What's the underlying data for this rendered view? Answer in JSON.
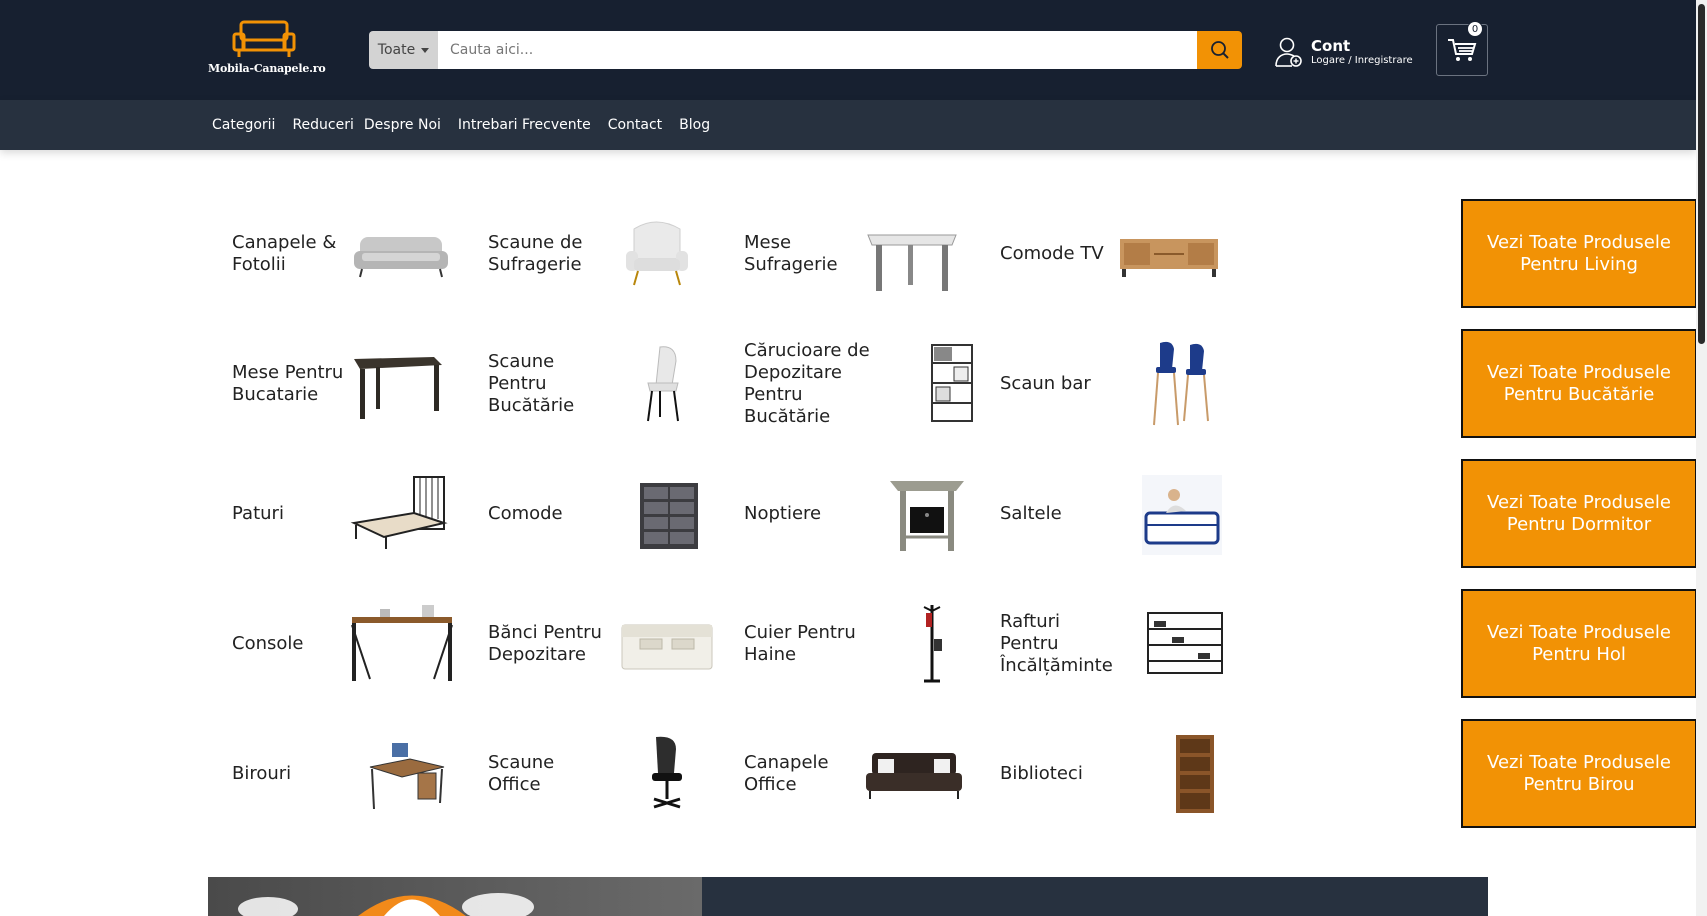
{
  "brand": {
    "logo_text": "Mobila-Canapele.ro",
    "accent": "#f29205",
    "header_bg": "#172030",
    "nav_bg": "#27313f"
  },
  "search": {
    "category": "Toate",
    "placeholder": "Cauta aici..."
  },
  "account": {
    "title": "Cont",
    "subtitle": "Logare / Inregistrare"
  },
  "cart": {
    "count": "0"
  },
  "nav": {
    "items": [
      "Categorii",
      "Reduceri",
      "Despre Noi",
      "Intrebari Frecvente",
      "Contact",
      "Blog"
    ]
  },
  "categories": {
    "rows": [
      {
        "items": [
          "Canapele & Fotolii",
          "Scaune de Sufragerie",
          "Mese Sufragerie",
          "Comode TV"
        ],
        "cta": "Vezi Toate Produsele Pentru Living"
      },
      {
        "items": [
          "Mese Pentru Bucatarie",
          "Scaune Pentru Bucătărie",
          "Cărucioare de Depozitare Pentru Bucătărie",
          "Scaun bar"
        ],
        "cta": "Vezi Toate Produsele Pentru Bucătărie"
      },
      {
        "items": [
          "Paturi",
          "Comode",
          "Noptiere",
          "Saltele"
        ],
        "cta": "Vezi Toate Produsele Pentru Dormitor"
      },
      {
        "items": [
          "Console",
          "Bănci Pentru Depozitare",
          "Cuier Pentru Haine",
          "Rafturi Pentru Încălțăminte"
        ],
        "cta": "Vezi Toate Produsele Pentru Hol"
      },
      {
        "items": [
          "Birouri",
          "Scaune Office",
          "Canapele Office",
          "Biblioteci"
        ],
        "cta": "Vezi Toate Produsele Pentru Birou"
      }
    ],
    "icons": [
      [
        "sofa-image",
        "armchair-image",
        "dining-table-image",
        "tv-stand-image"
      ],
      [
        "kitchen-table-image",
        "kitchen-chair-image",
        "kitchen-cart-image",
        "bar-stools-image"
      ],
      [
        "bed-frame-image",
        "dresser-image",
        "nightstand-image",
        "mattress-image"
      ],
      [
        "console-table-image",
        "storage-bench-image",
        "coat-rack-image",
        "shoe-rack-image"
      ],
      [
        "desk-image",
        "office-chair-image",
        "office-sofa-image",
        "bookcase-image"
      ]
    ]
  }
}
